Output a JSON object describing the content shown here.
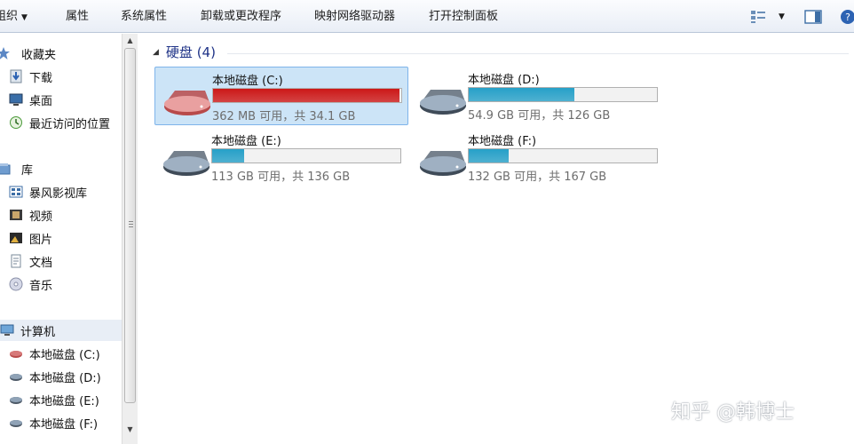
{
  "toolbar": {
    "organize": "组织",
    "properties": "属性",
    "system_properties": "系统属性",
    "uninstall": "卸载或更改程序",
    "map_drive": "映射网络驱动器",
    "control_panel": "打开控制面板"
  },
  "nav": {
    "favorites": "收藏夹",
    "downloads": "下载",
    "desktop": "桌面",
    "recent": "最近访问的位置",
    "libraries": "库",
    "storm_video": "暴风影视库",
    "videos": "视频",
    "pictures": "图片",
    "documents": "文档",
    "music": "音乐",
    "computer": "计算机",
    "drive_c": "本地磁盘 (C:)",
    "drive_d": "本地磁盘 (D:)",
    "drive_e": "本地磁盘 (E:)",
    "drive_f": "本地磁盘 (F:)"
  },
  "content": {
    "group_title": "硬盘 (4)",
    "drives": [
      {
        "name": "本地磁盘 (C:)",
        "info": "362 MB 可用，共 34.1 GB",
        "used_fraction": 0.99,
        "bar_color": "#cc1818",
        "icon_color": "#b84a4a"
      },
      {
        "name": "本地磁盘 (D:)",
        "info": "54.9 GB 可用，共 126 GB",
        "used_fraction": 0.56,
        "bar_color": "#26a0c8",
        "icon_color": "#5d6a78"
      },
      {
        "name": "本地磁盘 (E:)",
        "info": "113 GB 可用，共 136 GB",
        "used_fraction": 0.17,
        "bar_color": "#26a0c8",
        "icon_color": "#5d6a78"
      },
      {
        "name": "本地磁盘 (F:)",
        "info": "132 GB 可用，共 167 GB",
        "used_fraction": 0.21,
        "bar_color": "#26a0c8",
        "icon_color": "#5d6a78"
      }
    ]
  },
  "watermark": "知乎 @韩博士",
  "colors": {
    "accent": "#1e3287",
    "selection": "#cce4f7"
  }
}
